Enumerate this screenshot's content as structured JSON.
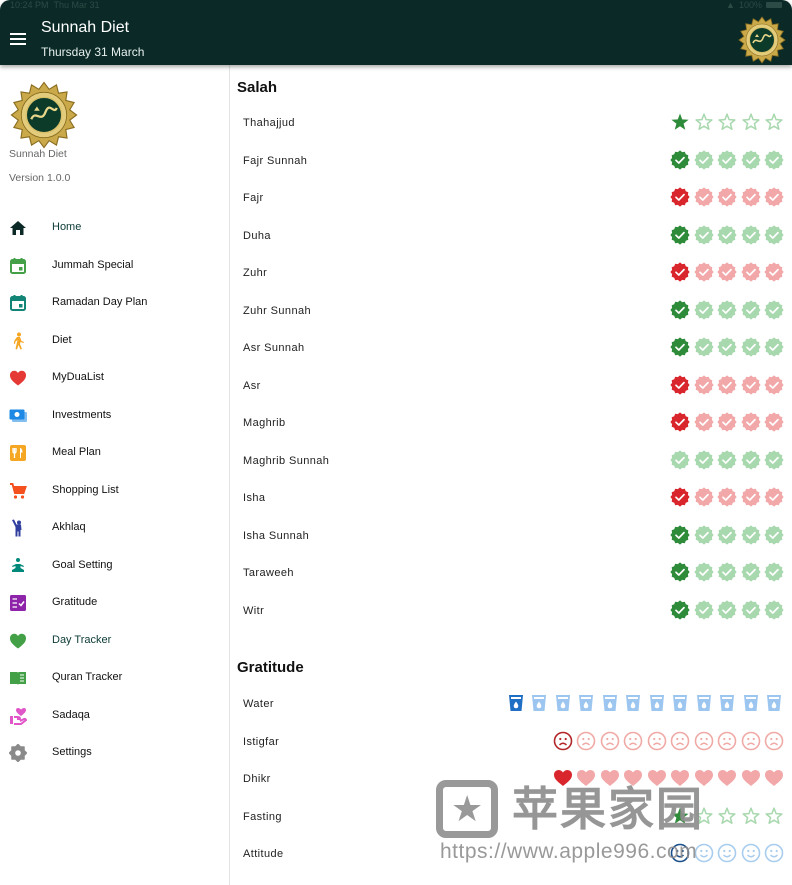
{
  "status_bar": {
    "time": "10:24 PM",
    "date": "Thu Mar 31",
    "battery": "100%"
  },
  "appbar": {
    "title": "Sunnah Diet",
    "subtitle": "Thursday 31 March",
    "menu_icon": "hamburger-menu-icon",
    "logo_icon": "muhammad-calligraphy-emblem"
  },
  "sidebar": {
    "app_name": "Sunnah Diet",
    "version": "Version 1.0.0",
    "items": [
      {
        "label": "Home",
        "icon": "home-icon",
        "color": "#0b2a27",
        "active": false,
        "highlight": true
      },
      {
        "label": "Jummah Special",
        "icon": "calendar-icon",
        "color": "#43a047"
      },
      {
        "label": "Ramadan Day Plan",
        "icon": "calendar-icon",
        "color": "#138577"
      },
      {
        "label": "Diet",
        "icon": "walking-icon",
        "color": "#f5a623"
      },
      {
        "label": "MyDuaList",
        "icon": "heart-icon",
        "color": "#e53935"
      },
      {
        "label": "Investments",
        "icon": "money-icon",
        "color": "#1e88e5"
      },
      {
        "label": "Meal Plan",
        "icon": "restaurant-icon",
        "color": "#f5a623"
      },
      {
        "label": "Shopping List",
        "icon": "cart-icon",
        "color": "#f4511e"
      },
      {
        "label": "Akhlaq",
        "icon": "person-wave-icon",
        "color": "#303f9f"
      },
      {
        "label": "Goal Setting",
        "icon": "meditation-icon",
        "color": "#00897b"
      },
      {
        "label": "Gratitude",
        "icon": "checklist-icon",
        "color": "#8e24aa"
      },
      {
        "label": "Day Tracker",
        "icon": "heart-icon",
        "color": "#43a047",
        "active": true
      },
      {
        "label": "Quran Tracker",
        "icon": "book-icon",
        "color": "#43a047"
      },
      {
        "label": "Sadaqa",
        "icon": "charity-icon",
        "color": "#e056c9"
      },
      {
        "label": "Settings",
        "icon": "gear-icon",
        "color": "#8a8a8a"
      }
    ]
  },
  "salah": {
    "title": "Salah",
    "rows": [
      {
        "label": "Thahajjud",
        "type": "star",
        "count": 5,
        "value": 1,
        "tone": "green"
      },
      {
        "label": "Fajr Sunnah",
        "type": "badge",
        "count": 5,
        "value": 1,
        "tone": "green"
      },
      {
        "label": "Fajr",
        "type": "badge",
        "count": 5,
        "value": 1,
        "tone": "red"
      },
      {
        "label": "Duha",
        "type": "badge",
        "count": 5,
        "value": 1,
        "tone": "green"
      },
      {
        "label": "Zuhr",
        "type": "badge",
        "count": 5,
        "value": 1,
        "tone": "red"
      },
      {
        "label": "Zuhr Sunnah",
        "type": "badge",
        "count": 5,
        "value": 1,
        "tone": "green"
      },
      {
        "label": "Asr Sunnah",
        "type": "badge",
        "count": 5,
        "value": 1,
        "tone": "green"
      },
      {
        "label": "Asr",
        "type": "badge",
        "count": 5,
        "value": 1,
        "tone": "red"
      },
      {
        "label": "Maghrib",
        "type": "badge",
        "count": 5,
        "value": 1,
        "tone": "red"
      },
      {
        "label": "Maghrib Sunnah",
        "type": "badge",
        "count": 5,
        "value": 0,
        "tone": "green"
      },
      {
        "label": "Isha",
        "type": "badge",
        "count": 5,
        "value": 1,
        "tone": "red"
      },
      {
        "label": "Isha Sunnah",
        "type": "badge",
        "count": 5,
        "value": 1,
        "tone": "green"
      },
      {
        "label": "Taraweeh",
        "type": "badge",
        "count": 5,
        "value": 1,
        "tone": "green"
      },
      {
        "label": "Witr",
        "type": "badge",
        "count": 5,
        "value": 1,
        "tone": "green"
      }
    ]
  },
  "gratitude": {
    "title": "Gratitude",
    "rows": [
      {
        "label": "Water",
        "type": "cup",
        "count": 12,
        "value": 1,
        "tone": "blue"
      },
      {
        "label": "Istigfar",
        "type": "sad",
        "count": 10,
        "value": 1,
        "tone": "redface"
      },
      {
        "label": "Dhikr",
        "type": "heart",
        "count": 10,
        "value": 1,
        "tone": "red"
      },
      {
        "label": "Fasting",
        "type": "star",
        "count": 5,
        "value": 1,
        "tone": "green"
      },
      {
        "label": "Attitude",
        "type": "smile",
        "count": 5,
        "value": 1,
        "tone": "blueface"
      }
    ]
  },
  "colors": {
    "green_on": "#2e8b3a",
    "green_off": "#a8d8ae",
    "red_on": "#d9262c",
    "red_off": "#f2a7a8",
    "blue_on": "#1f6fc5",
    "blue_off": "#9cc6ef",
    "redface_on": "#b3262a",
    "redface_off": "#f0aaa6",
    "blueface_on": "#1a4f8a",
    "blueface_off": "#a9cdee"
  },
  "watermark": {
    "brand": "苹果家园",
    "url": "https://www.apple996.com"
  }
}
